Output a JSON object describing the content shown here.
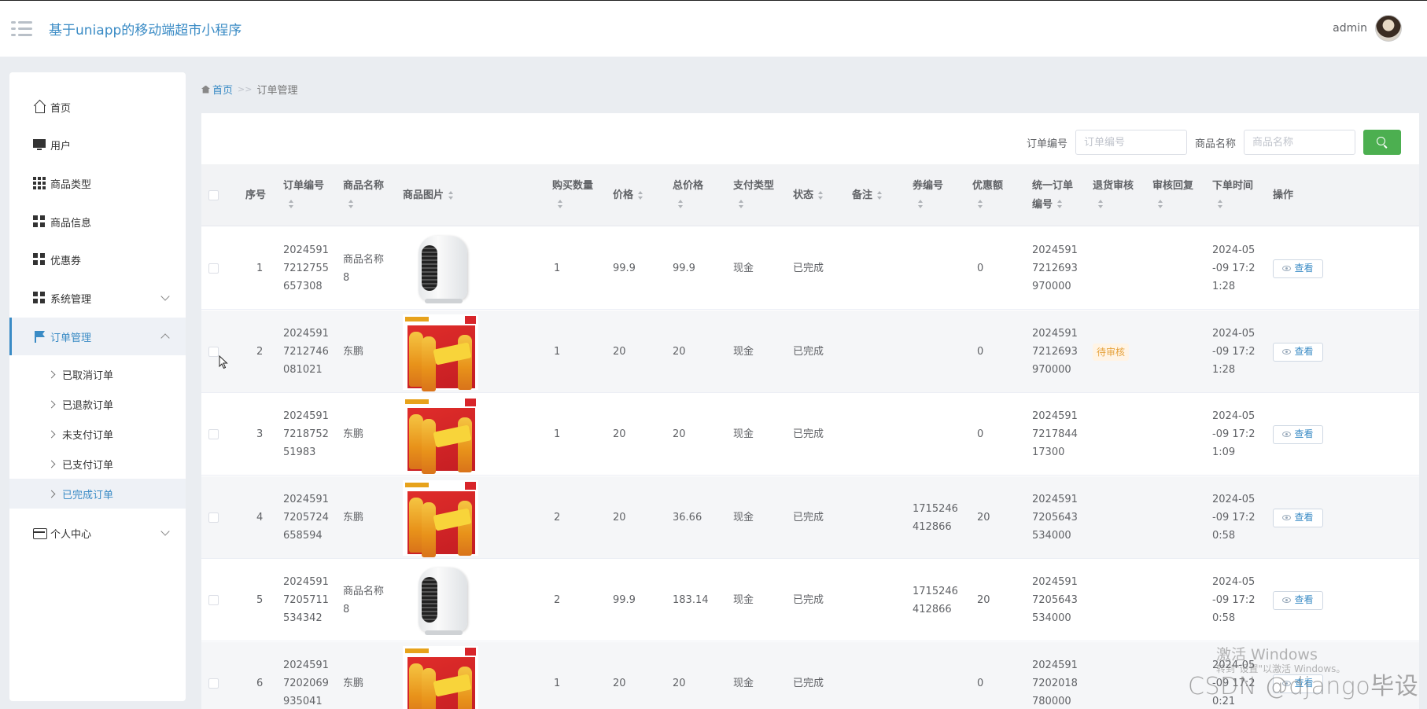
{
  "header": {
    "title": "基于uniapp的移动端超市小程序",
    "username": "admin"
  },
  "sidebar": {
    "items": [
      {
        "label": "首页"
      },
      {
        "label": "用户"
      },
      {
        "label": "商品类型"
      },
      {
        "label": "商品信息"
      },
      {
        "label": "优惠券"
      },
      {
        "label": "系统管理"
      },
      {
        "label": "订单管理"
      },
      {
        "label": "个人中心"
      }
    ],
    "order_sub_items": [
      {
        "label": "已取消订单"
      },
      {
        "label": "已退款订单"
      },
      {
        "label": "未支付订单"
      },
      {
        "label": "已支付订单"
      },
      {
        "label": "已完成订单"
      }
    ]
  },
  "breadcrumb": {
    "home": "首页",
    "separator": ">>",
    "current": "订单管理"
  },
  "search": {
    "order_no_label": "订单编号",
    "order_no_placeholder": "订单编号",
    "product_name_label": "商品名称",
    "product_name_placeholder": "商品名称"
  },
  "table": {
    "headers": {
      "index": "序号",
      "order_no": "订单编号",
      "product_name": "商品名称",
      "product_image": "商品图片",
      "quantity": "购买数量",
      "price": "价格",
      "total": "总价格",
      "pay_type": "支付类型",
      "status": "状态",
      "remark": "备注",
      "coupon_no": "券编号",
      "discount": "优惠额",
      "unified_no_1": "统一订单",
      "unified_no_2": "编号",
      "refund_review": "退货审核",
      "review_reply": "审核回复",
      "order_time": "下单时间",
      "action": "操作"
    },
    "view_label": "查看",
    "rows": [
      {
        "index": "1",
        "order_no": [
          "2024591",
          "7212755",
          "657308"
        ],
        "product_name": [
          "商品名称",
          "8"
        ],
        "image": "heater",
        "quantity": "1",
        "price": "99.9",
        "total": "99.9",
        "pay_type": "现金",
        "status": "已完成",
        "coupon_no": [
          "",
          ""
        ],
        "discount": "0",
        "unified_no": [
          "2024591",
          "7212693",
          "970000"
        ],
        "refund_review": "",
        "order_time": [
          "2024-05",
          "-09 17:2",
          "1:28"
        ]
      },
      {
        "index": "2",
        "order_no": [
          "2024591",
          "7212746",
          "081021"
        ],
        "product_name": [
          "东鹏",
          ""
        ],
        "image": "drink",
        "quantity": "1",
        "price": "20",
        "total": "20",
        "pay_type": "现金",
        "status": "已完成",
        "coupon_no": [
          "",
          ""
        ],
        "discount": "0",
        "unified_no": [
          "2024591",
          "7212693",
          "970000"
        ],
        "refund_review": "待审核",
        "order_time": [
          "2024-05",
          "-09 17:2",
          "1:28"
        ]
      },
      {
        "index": "3",
        "order_no": [
          "2024591",
          "7218752",
          "51983"
        ],
        "product_name": [
          "东鹏",
          ""
        ],
        "image": "drink",
        "quantity": "1",
        "price": "20",
        "total": "20",
        "pay_type": "现金",
        "status": "已完成",
        "coupon_no": [
          "",
          ""
        ],
        "discount": "0",
        "unified_no": [
          "2024591",
          "7217844",
          "17300"
        ],
        "refund_review": "",
        "order_time": [
          "2024-05",
          "-09 17:2",
          "1:09"
        ]
      },
      {
        "index": "4",
        "order_no": [
          "2024591",
          "7205724",
          "658594"
        ],
        "product_name": [
          "东鹏",
          ""
        ],
        "image": "drink",
        "quantity": "2",
        "price": "20",
        "total": "36.66",
        "pay_type": "现金",
        "status": "已完成",
        "coupon_no": [
          "1715246",
          "412866"
        ],
        "discount": "20",
        "unified_no": [
          "2024591",
          "7205643",
          "534000"
        ],
        "refund_review": "",
        "order_time": [
          "2024-05",
          "-09 17:2",
          "0:58"
        ]
      },
      {
        "index": "5",
        "order_no": [
          "2024591",
          "7205711",
          "534342"
        ],
        "product_name": [
          "商品名称",
          "8"
        ],
        "image": "heater",
        "quantity": "2",
        "price": "99.9",
        "total": "183.14",
        "pay_type": "现金",
        "status": "已完成",
        "coupon_no": [
          "1715246",
          "412866"
        ],
        "discount": "20",
        "unified_no": [
          "2024591",
          "7205643",
          "534000"
        ],
        "refund_review": "",
        "order_time": [
          "2024-05",
          "-09 17:2",
          "0:58"
        ]
      },
      {
        "index": "6",
        "order_no": [
          "2024591",
          "7202069",
          "935041"
        ],
        "product_name": [
          "东鹏",
          ""
        ],
        "image": "drink",
        "quantity": "1",
        "price": "20",
        "total": "20",
        "pay_type": "现金",
        "status": "已完成",
        "coupon_no": [
          "",
          ""
        ],
        "discount": "0",
        "unified_no": [
          "2024591",
          "7202018",
          "780000"
        ],
        "refund_review": "",
        "order_time": [
          "2024-05",
          "-09 17:2",
          "0:21"
        ]
      }
    ]
  },
  "watermark": {
    "activate_title": "激活 Windows",
    "activate_sub": "转到\"设置\"以激活 Windows。",
    "csdn": "CSDN @django毕设"
  },
  "colors": {
    "accent": "#3a8bc5",
    "search_button": "#4caf50",
    "header_bg": "#ffffff",
    "page_bg": "#eaedf1"
  }
}
